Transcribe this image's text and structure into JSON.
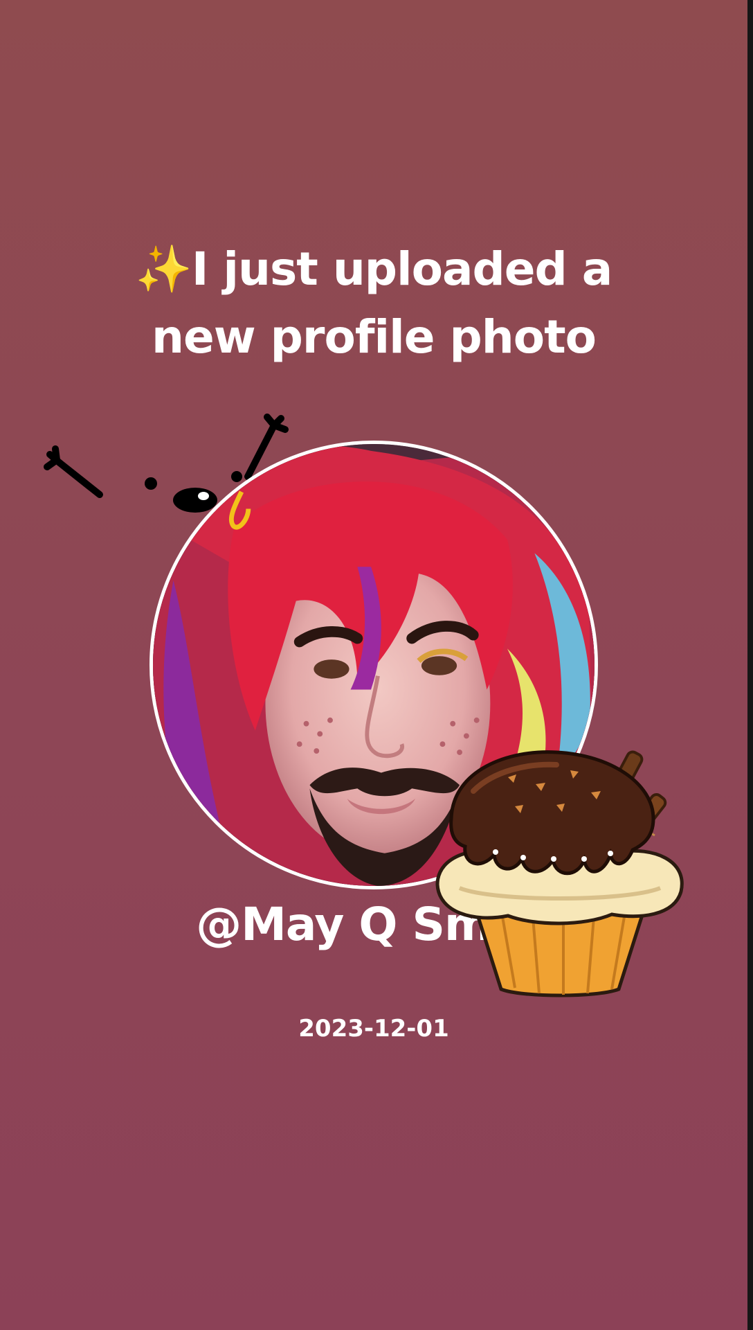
{
  "post": {
    "sparkles": "✨",
    "headline": "I just uploaded a new profile photo",
    "username": "@May Q Smile",
    "date": "2023-12-01"
  },
  "colors": {
    "background_top": "#8f4b4f",
    "background_bottom": "#8c4157",
    "text": "#ffffff",
    "avatar_border": "#ffffff"
  },
  "icons": {
    "sparkles": "sparkles-icon",
    "doodle": "doodle-sticker",
    "cupcake": "cupcake-sticker"
  }
}
